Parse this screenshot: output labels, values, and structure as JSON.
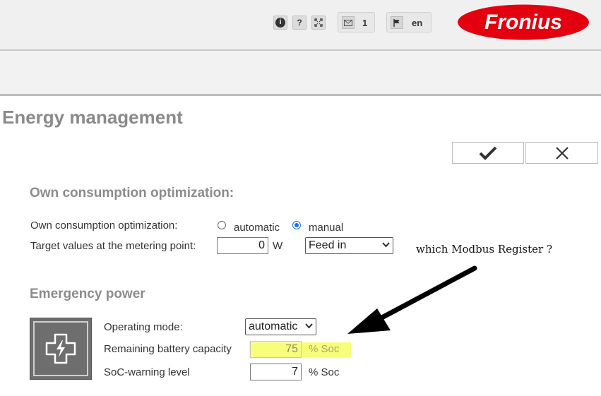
{
  "header": {
    "info_label": "i",
    "help_label": "?",
    "messages_count": "1",
    "language": "en",
    "logo_text": "Fronius"
  },
  "page": {
    "title": "Energy management"
  },
  "own_consumption": {
    "heading": "Own consumption optimization:",
    "mode_label": "Own consumption optimization:",
    "option_automatic": "automatic",
    "option_manual": "manual",
    "selected": "manual",
    "target_label": "Target values at the metering point:",
    "target_value": "0",
    "target_unit": "W",
    "direction_selected": "Feed in"
  },
  "emergency_power": {
    "heading": "Emergency power",
    "operating_mode_label": "Operating mode:",
    "operating_mode_selected": "automatic",
    "remaining_label": "Remaining battery capacity",
    "remaining_value": "75",
    "remaining_unit": "% Soc",
    "warning_label": "SoC-warning level",
    "warning_value": "7",
    "warning_unit": "% Soc"
  },
  "annotation": {
    "text": "which Modbus Register ?"
  },
  "colors": {
    "logo_red": "#e3000f",
    "highlight": "#f7ff7a",
    "heading_gray": "#8c8c8c"
  }
}
